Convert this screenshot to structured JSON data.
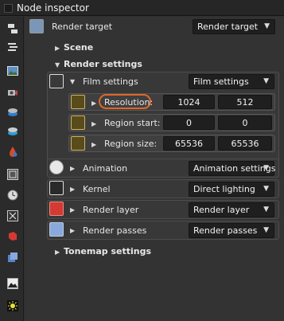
{
  "window": {
    "title": "Node inspector"
  },
  "toolbar": {
    "icons": [
      "node-graph-icon",
      "node-list-icon",
      "image-icon",
      "camera-icon",
      "material-icon",
      "texture-icon",
      "color-picker-icon",
      "film-settings-icon",
      "animation-icon",
      "kernel-icon",
      "render-layer-icon",
      "render-passes-icon",
      "image-output-icon",
      "light-icon"
    ]
  },
  "render_target": {
    "label": "Render target",
    "value": "Render target"
  },
  "scene": {
    "label": "Scene"
  },
  "render_settings": {
    "label": "Render settings"
  },
  "film_settings": {
    "label": "Film settings",
    "value": "Film settings"
  },
  "resolution": {
    "label": "Resolution:",
    "x": "1024",
    "y": "512"
  },
  "region_start": {
    "label": "Region start:",
    "x": "0",
    "y": "0"
  },
  "region_size": {
    "label": "Region size:",
    "x": "65536",
    "y": "65536"
  },
  "animation": {
    "label": "Animation",
    "value": "Animation settings"
  },
  "kernel": {
    "label": "Kernel",
    "value": "Direct lighting"
  },
  "render_layer": {
    "label": "Render layer",
    "value": "Render layer"
  },
  "render_passes": {
    "label": "Render passes",
    "value": "Render passes"
  },
  "tonemap": {
    "label": "Tonemap settings"
  },
  "colors": {
    "highlight": "#e0672a",
    "render_layer_icon": "#d23a32",
    "render_passes_icon": "#5a84c8"
  }
}
